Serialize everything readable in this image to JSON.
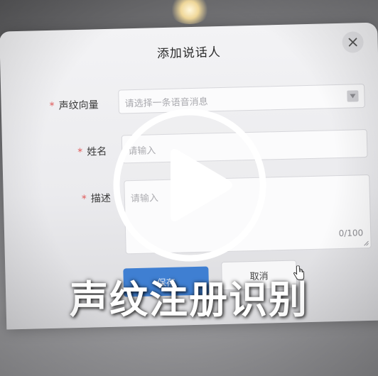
{
  "dialog": {
    "title": "添加说话人",
    "close_icon": "close-icon",
    "fields": {
      "voiceprint": {
        "required_mark": "*",
        "label": "声纹向量",
        "placeholder": "请选择一条语音消息"
      },
      "name": {
        "required_mark": "*",
        "label": "姓名",
        "placeholder": "请输入"
      },
      "description": {
        "required_mark": "*",
        "label": "描述",
        "placeholder": "请输入",
        "counter": "0/100"
      }
    },
    "buttons": {
      "save": "保存",
      "cancel": "取消"
    }
  },
  "overlay": {
    "play_icon": "play-icon",
    "caption": "声纹注册识别"
  },
  "colors": {
    "primary": "#3f7fd2",
    "required": "#e05a5a"
  }
}
